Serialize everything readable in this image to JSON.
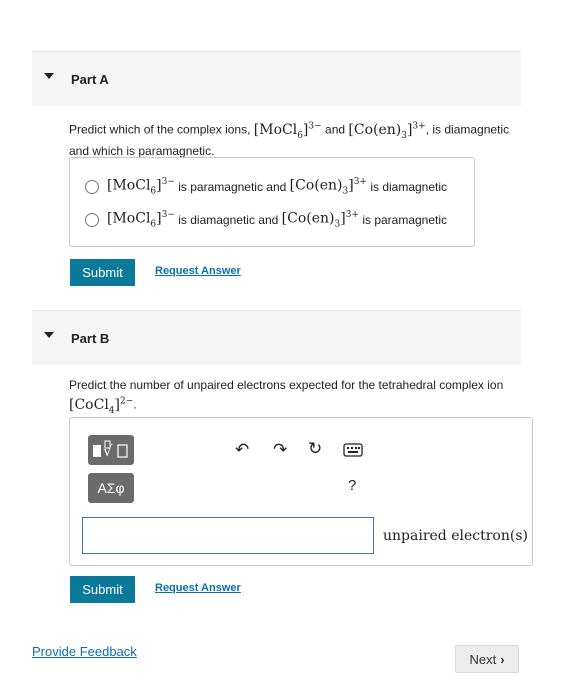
{
  "partA": {
    "title": "Part A",
    "question_prefix": "Predict which of the complex ions,",
    "ion1": "[MoCl",
    "ion1_sub": "6",
    "ion1_end": "]",
    "ion1_charge": "3−",
    "and": "and",
    "ion2": "[Co(en)",
    "ion2_sub": "3",
    "ion2_end": "]",
    "ion2_charge": "3+",
    "question_suffix": ", is diamagnetic",
    "question_line2": "and which is paramagnetic.",
    "options": [
      {
        "mid": "is paramagnetic and",
        "end": "is diamagnetic"
      },
      {
        "mid": "is diamagnetic and",
        "end": "is paramagnetic"
      }
    ],
    "submit": "Submit",
    "request": "Request Answer"
  },
  "partB": {
    "title": "Part B",
    "question_line1": "Predict the number of unpaired electrons expected for the tetrahedral complex ion",
    "ion": "[CoCl",
    "ion_sub": "4",
    "ion_end": "]",
    "ion_charge": "2−",
    "ion_period": ".",
    "toolbar": {
      "greek_label": "ΑΣφ",
      "help_label": "?"
    },
    "input_value": "",
    "unit": "unpaired electron(s)",
    "submit": "Submit",
    "request": "Request Answer"
  },
  "footer": {
    "feedback": "Provide Feedback",
    "next": "Next"
  }
}
